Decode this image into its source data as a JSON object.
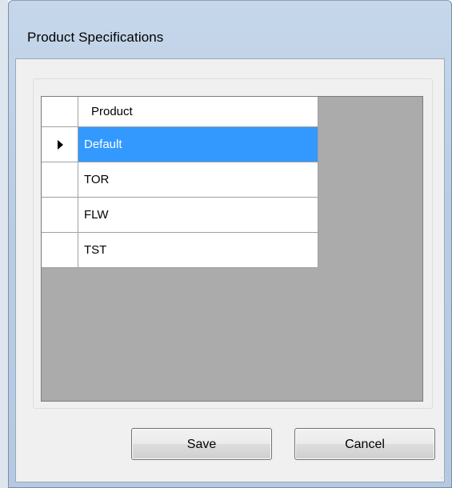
{
  "window": {
    "title": "Product Specifications"
  },
  "grid": {
    "column_header": "Product",
    "rows": [
      {
        "value": "Default",
        "selected": true,
        "current": true
      },
      {
        "value": "TOR",
        "selected": false,
        "current": false
      },
      {
        "value": "FLW",
        "selected": false,
        "current": false
      },
      {
        "value": "TST",
        "selected": false,
        "current": false
      }
    ]
  },
  "buttons": {
    "save_label": "Save",
    "cancel_label": "Cancel"
  },
  "colors": {
    "selection": "#3399ff",
    "grid_background": "#ababab"
  },
  "icons": {
    "current_row": "triangle-right-icon",
    "resize": "size-grip-icon"
  }
}
